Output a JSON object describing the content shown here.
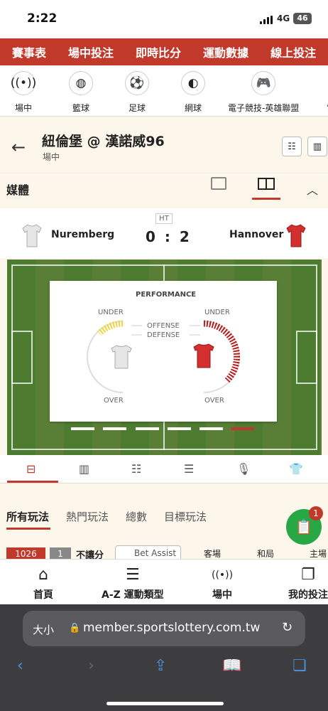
{
  "status_bar": {
    "time": "2:22",
    "network": "4G",
    "battery": "46"
  },
  "top_nav": [
    "賽事表",
    "場中投注",
    "即時比分",
    "運動數據",
    "線上投注"
  ],
  "sports": [
    {
      "label": "場中",
      "icon": "live-icon"
    },
    {
      "label": "籃球",
      "icon": "basketball-icon"
    },
    {
      "label": "足球",
      "icon": "soccer-icon"
    },
    {
      "label": "網球",
      "icon": "tennis-icon"
    },
    {
      "label": "電子競技-英雄聯盟",
      "icon": "gamepad-icon"
    },
    {
      "label": "電",
      "icon": "partial-icon"
    }
  ],
  "match": {
    "title": "紐倫堡 @ 漢諾威96",
    "status": "場中"
  },
  "media": {
    "label": "媒體"
  },
  "scoreboard": {
    "period": "HT",
    "home_team": "Nuremberg",
    "away_team": "Hannover",
    "score": "0 : 2",
    "home_shirt_color": "#e6e6e6",
    "away_shirt_color": "#d32f2f"
  },
  "performance": {
    "title": "PERFORMANCE",
    "under": "UNDER",
    "over": "OVER",
    "offense": "OFFENSE",
    "defense": "DEFENSE",
    "home_arc_color": "#f2d33b",
    "away_arc_color": "#b71c1c"
  },
  "play_tabs": [
    "所有玩法",
    "熱門玩法",
    "總數",
    "目標玩法"
  ],
  "odds_header": {
    "badge1": "1026",
    "badge2": "1",
    "label": "不讓分",
    "bet_assist": "Bet Assist",
    "cols": [
      "客場",
      "和局",
      "主場"
    ]
  },
  "fab": {
    "badge": "1"
  },
  "bottom_nav": [
    {
      "label": "首頁",
      "icon": "home-icon"
    },
    {
      "label": "A-Z 運動類型",
      "icon": "menu-icon"
    },
    {
      "label": "場中",
      "icon": "live-icon"
    },
    {
      "label": "我的投注",
      "icon": "bets-icon"
    }
  ],
  "browser": {
    "text_size": "大小",
    "url": "member.sportslottery.com.tw"
  },
  "colors": {
    "brand": "#c0392b",
    "background": "#fdf6ea",
    "field": "#4d7b2f"
  }
}
